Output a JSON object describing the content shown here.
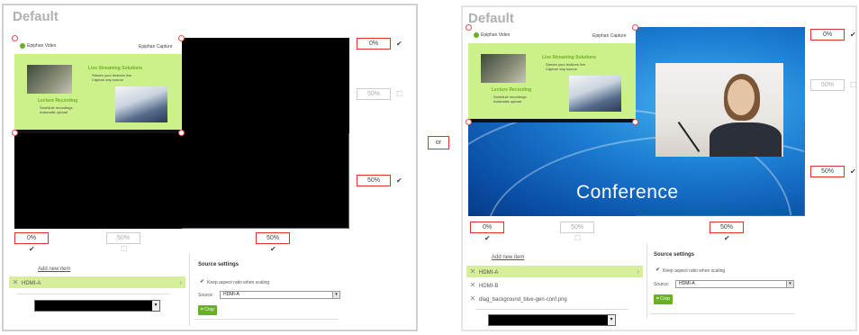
{
  "left": {
    "title": "Default",
    "slide": {
      "brand": "Epiphan Video",
      "capture_logo": "Epiphan Capture",
      "heading1": "Live Streaming Solutions",
      "heading2": "Lecture Recording",
      "bullets1": [
        "Stream your lectures live",
        "Capture any source"
      ],
      "bullets2": [
        "Schedule recordings",
        "Automatic upload"
      ]
    },
    "percent_right_top": "0%",
    "percent_right_mid": "50%",
    "percent_right_bottom": "50%",
    "percent_bottom_left": "0%",
    "percent_bottom_mid": "50%",
    "percent_bottom_right": "50%",
    "add_new_item": "Add new item",
    "items": [
      {
        "label": "HDMI-A",
        "selected": true
      }
    ],
    "source_settings": {
      "title": "Source settings",
      "keep_aspect": "Keep aspect ratio when scaling",
      "source_label": "Source:",
      "source_value": "HDMI-A",
      "crop_label": "Crop"
    }
  },
  "or_label": "or",
  "right": {
    "title": "Default",
    "conference_text": "Conference",
    "percent_right_top": "0%",
    "percent_right_mid": "50%",
    "percent_right_bottom": "50%",
    "percent_bottom_left": "0%",
    "percent_bottom_mid": "50%",
    "percent_bottom_right": "50%",
    "add_new_item": "Add new item",
    "items": [
      {
        "label": "HDMI-A",
        "selected": true
      },
      {
        "label": "HDMI-B",
        "selected": false
      },
      {
        "label": "dlag_background_blue-gen-conf.png",
        "selected": false
      }
    ],
    "source_settings": {
      "title": "Source settings",
      "keep_aspect": "Keep aspect ratio when scaling",
      "source_label": "Source:",
      "source_value": "HDMI-A",
      "crop_label": "Crop"
    }
  },
  "colors": {
    "accent_red": "#dd3333",
    "selection_green": "#d7ee9b",
    "crop_green": "#6ab023",
    "conference_blue": "#1d7fd3"
  },
  "icons": [
    "checkbox-icon",
    "remove-x-icon",
    "chevron-right-icon",
    "dropdown-arrow-icon",
    "crop-icon"
  ]
}
